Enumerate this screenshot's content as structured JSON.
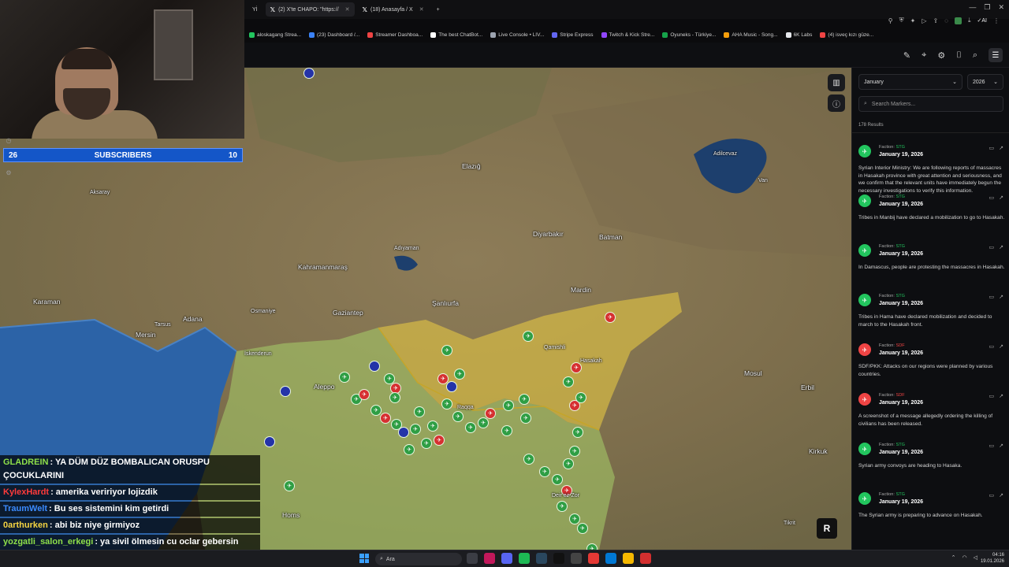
{
  "browser": {
    "tabs": [
      {
        "label": "Yİ",
        "active": false
      },
      {
        "label": "(2) X'te CHAPO: \"https://",
        "active": true
      },
      {
        "label": "(18) Anasayfa / X",
        "active": false
      }
    ],
    "new_tab": "+",
    "ai_label": "AI",
    "bookmarks": [
      {
        "label": "aloskagang Strea...",
        "color": "#22c55e"
      },
      {
        "label": "(23) Dashboard /...",
        "color": "#3b82f6"
      },
      {
        "label": "Streamer Dashboa...",
        "color": "#ef4444"
      },
      {
        "label": "The best ChatBot...",
        "color": "#ffffff"
      },
      {
        "label": "Live Console • LIV...",
        "color": "#9ca3af"
      },
      {
        "label": "Stripe Express",
        "color": "#6366f1"
      },
      {
        "label": "Twitch & Kick Stre...",
        "color": "#9146ff"
      },
      {
        "label": "Oyuneks - Türkiye...",
        "color": "#16a34a"
      },
      {
        "label": "AHA Music - Song...",
        "color": "#f59e0b"
      },
      {
        "label": "6K Labs",
        "color": "#e5e7eb"
      },
      {
        "label": "(4) isveç kızı güze...",
        "color": "#ef4444"
      }
    ]
  },
  "stream": {
    "subscribers_left": "26",
    "subscribers_label": "SUBSCRIBERS",
    "subscribers_right": "10",
    "chat": [
      {
        "name": "GLADREIN",
        "color": "#8ee04a",
        "text": ": YA DÜM DÜZ BOMBALICAN ORUSPU ÇOCUKLARINI"
      },
      {
        "name": "KylexHardt",
        "color": "#ff3b3b",
        "text": ": amerika veririyor lojizdik"
      },
      {
        "name": "TraumWelt",
        "color": "#3b8bff",
        "text": ": Bu ses sistemini kim getirdi"
      },
      {
        "name": "0arthurken",
        "color": "#f5d442",
        "text": ": abi biz niye girmiyoz"
      },
      {
        "name": "yozgatli_salon_erkegi",
        "color": "#8ee04a",
        "text": ": ya sivil ölmesin cu oclar gebersin artık allahım yap sunu ya"
      }
    ]
  },
  "map": {
    "cities": [
      {
        "name": "Elazığ"
      },
      {
        "name": "Van"
      },
      {
        "name": "Adilcevaz"
      },
      {
        "name": "Diyarbakır"
      },
      {
        "name": "Batman"
      },
      {
        "name": "Adıyaman"
      },
      {
        "name": "Kahramanmaraş"
      },
      {
        "name": "Şanlıurfa"
      },
      {
        "name": "Mardin"
      },
      {
        "name": "Gaziantep"
      },
      {
        "name": "Osmaniye"
      },
      {
        "name": "Adana"
      },
      {
        "name": "Mersin"
      },
      {
        "name": "Tarsus"
      },
      {
        "name": "Karaman"
      },
      {
        "name": "Aksaray"
      },
      {
        "name": "İskenderun"
      },
      {
        "name": "Aleppo"
      },
      {
        "name": "Hasakah"
      },
      {
        "name": "Mosul"
      },
      {
        "name": "Erbil"
      },
      {
        "name": "Homs"
      },
      {
        "name": "Kirkuk"
      },
      {
        "name": "Tikrit"
      },
      {
        "name": "Qamishli"
      },
      {
        "name": "Raqqa"
      },
      {
        "name": "Deir ez-Zor"
      }
    ],
    "brand_letter": "R"
  },
  "sidebar": {
    "month": "January",
    "year": "2026",
    "search_placeholder": "Search Markers...",
    "results": "178 Results",
    "items": [
      {
        "faction_label": "Faction:",
        "faction": "STG",
        "date": "January 19, 2026",
        "color": "#22c55e",
        "text": "Syrian Interior Ministry: We are following reports of massacres in Hasakah province with great attention and seriousness, and we confirm that the relevant units have immediately begun the necessary investigations to verify this information."
      },
      {
        "faction_label": "Faction:",
        "faction": "STG",
        "date": "January 19, 2026",
        "color": "#22c55e",
        "text": "Tribes in Manbij have declared a mobilization to go to Hasakah."
      },
      {
        "faction_label": "Faction:",
        "faction": "STG",
        "date": "January 19, 2026",
        "color": "#22c55e",
        "text": "In Damascus, people are protesting the massacres in Hasakah."
      },
      {
        "faction_label": "Faction:",
        "faction": "STG",
        "date": "January 19, 2026",
        "color": "#22c55e",
        "text": "Tribes in Hama have declared mobilization and decided to march to the Hasakah front."
      },
      {
        "faction_label": "Faction:",
        "faction": "SDF",
        "date": "January 19, 2026",
        "color": "#ef4444",
        "text": "SDF/PKK: Attacks on our regions were planned by various countries."
      },
      {
        "faction_label": "Faction:",
        "faction": "SDF",
        "date": "January 19, 2026",
        "color": "#ef4444",
        "text": "A screenshot of a message allegedly ordering the killing of civilians has been released."
      },
      {
        "faction_label": "Faction:",
        "faction": "STG",
        "date": "January 19, 2026",
        "color": "#22c55e",
        "text": "Syrian army convoys are heading to Hasaka."
      },
      {
        "faction_label": "Faction:",
        "faction": "STG",
        "date": "January 19, 2026",
        "color": "#22c55e",
        "text": "The Syrian army is preparing to advance on Hasakah."
      }
    ]
  },
  "taskbar": {
    "search_label": "Ara",
    "time": "04:16",
    "date": "19.01.2026"
  }
}
